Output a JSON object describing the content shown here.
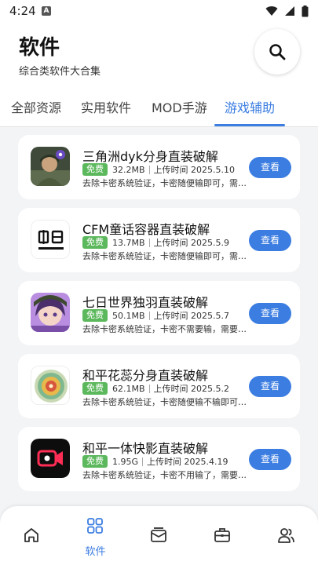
{
  "status_bar": {
    "time": "4:24",
    "notification_letter": "A"
  },
  "header": {
    "title": "软件",
    "subtitle": "综合类软件大合集"
  },
  "tabs": [
    {
      "label": "全部资源",
      "active": false
    },
    {
      "label": "实用软件",
      "active": false
    },
    {
      "label": "MOD手游",
      "active": false
    },
    {
      "label": "游戏辅助",
      "active": true
    }
  ],
  "items": [
    {
      "title": "三角洲dyk分身直装破解",
      "badge": "免费",
      "size": "32.2MB",
      "upload": "上传时间 2025.5.10",
      "desc": "去除卡密系统验证，卡密随便输即可，需要多开软件",
      "button": "查看",
      "icon": "soldier-game-icon"
    },
    {
      "title": "CFM童话容器直装破解",
      "badge": "免费",
      "size": "13.7MB",
      "upload": "上传时间 2025.5.9",
      "desc": "去除卡密系统验证，卡密随便输即可，需要多开软件",
      "button": "查看",
      "icon": "fairytale-logo-icon"
    },
    {
      "title": "七日世界独羽直装破解",
      "badge": "免费",
      "size": "50.1MB",
      "upload": "上传时间 2025.5.7",
      "desc": "去除卡密系统验证，卡密不需要输，需要多开软件",
      "button": "查看",
      "icon": "anime-girl-icon"
    },
    {
      "title": "和平花蕊分身直装破解",
      "badge": "免费",
      "size": "62.1MB",
      "upload": "上传时间 2025.5.2",
      "desc": "去除卡密系统验证，卡密随便输不输即可，需要多开",
      "button": "查看",
      "icon": "flower-emblem-icon"
    },
    {
      "title": "和平一体快影直装破解",
      "badge": "免费",
      "size": "1.95G",
      "upload": "上传时间 2025.4.19",
      "desc": "去除卡密系统验证，卡密不用输了，需要多开软件",
      "button": "查看",
      "icon": "video-camera-icon"
    }
  ],
  "bottom_nav": [
    {
      "name": "home",
      "label": "",
      "active": false
    },
    {
      "name": "software",
      "label": "软件",
      "active": true
    },
    {
      "name": "messages",
      "label": "",
      "active": false
    },
    {
      "name": "toolbox",
      "label": "",
      "active": false
    },
    {
      "name": "users",
      "label": "",
      "active": false
    }
  ],
  "colors": {
    "accent": "#3b7de1",
    "badge_green": "#5cb85c",
    "background": "#f3f4f6",
    "card": "#ffffff"
  }
}
